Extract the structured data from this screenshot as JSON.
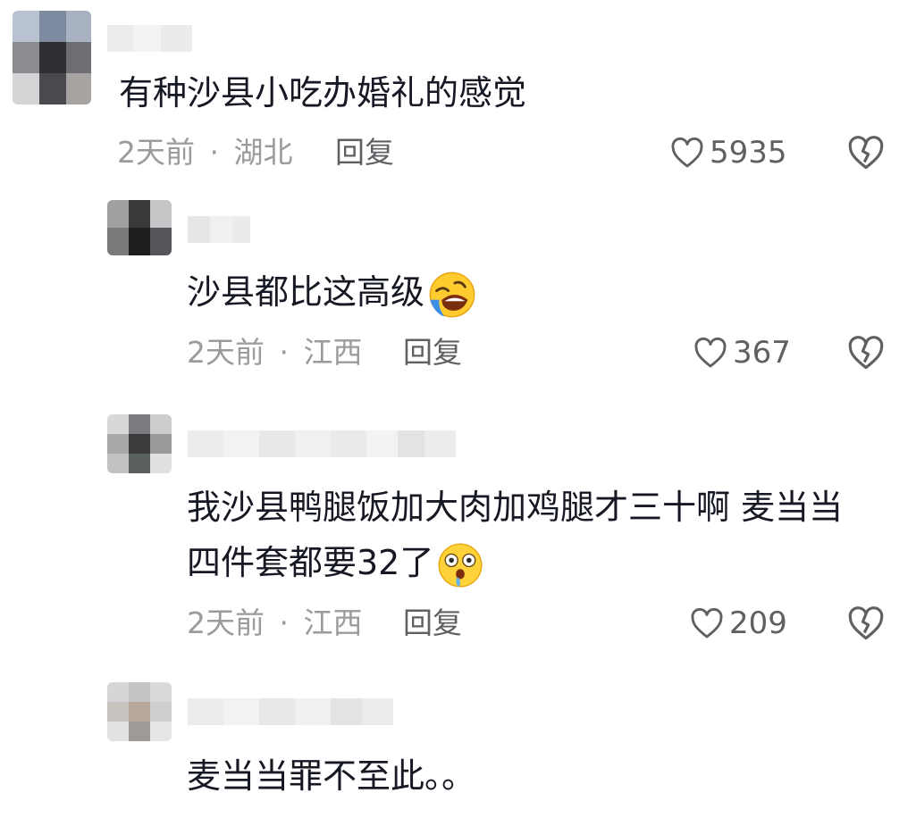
{
  "comments": [
    {
      "text_lines": [
        "有种沙县小吃办婚礼的感觉"
      ],
      "time": "2天前",
      "location": "湖北",
      "reply_label": "回复",
      "likes": "5935"
    },
    {
      "text_lines": [
        "沙县都比这高级"
      ],
      "emoji": "rolling-laugh-emoji",
      "time": "2天前",
      "location": "江西",
      "reply_label": "回复",
      "likes": "367"
    },
    {
      "text_lines": [
        "我沙县鸭腿饭加大肉加鸡腿才三十啊 麦当当",
        "四件套都要32了"
      ],
      "emoji": "drooling-shocked-emoji",
      "time": "2天前",
      "location": "江西",
      "reply_label": "回复",
      "likes": "209"
    },
    {
      "text_lines": [
        "麦当当罪不至此。。"
      ]
    }
  ],
  "meta_separator": "·",
  "icons": {
    "like": "heart-outline-icon",
    "dislike": "broken-heart-icon"
  },
  "colors": {
    "text": "#161823",
    "meta": "#9b9b9f",
    "action": "#5f5f64"
  }
}
